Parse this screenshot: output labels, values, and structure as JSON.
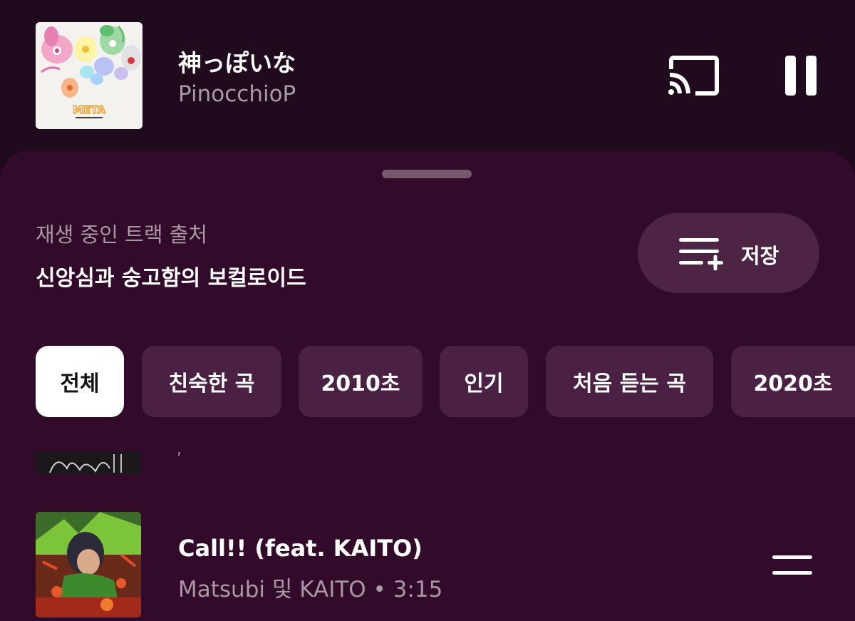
{
  "now_playing": {
    "title": "神っぽいな",
    "artist": "PinocchioP",
    "album_art_text": "META",
    "cast_icon": "cast-icon",
    "pause_icon": "pause-icon"
  },
  "sheet": {
    "source_label": "재생 중인 트랙 출처",
    "source_name": "신앙심과 숭고함의 보컬로이드",
    "save_label": "저장",
    "save_icon": "playlist-add-icon"
  },
  "chips": [
    {
      "label": "전체",
      "selected": true
    },
    {
      "label": "친숙한 곡",
      "selected": false
    },
    {
      "label": "2010초",
      "selected": false
    },
    {
      "label": "인기",
      "selected": false
    },
    {
      "label": "처음 듣는 곡",
      "selected": false
    },
    {
      "label": "2020초",
      "selected": false
    }
  ],
  "tracks": [
    {
      "title": "Call!! (feat. KAITO)",
      "meta": "Matsubi 및 KAITO • 3:15",
      "handle_icon": "drag-handle-icon"
    }
  ],
  "colors": {
    "background": "#1f0b1d",
    "sheet": "#320b2a",
    "chip": "#4a2142",
    "chip_active": "#ffffff",
    "secondary_text": "#a897a4"
  }
}
